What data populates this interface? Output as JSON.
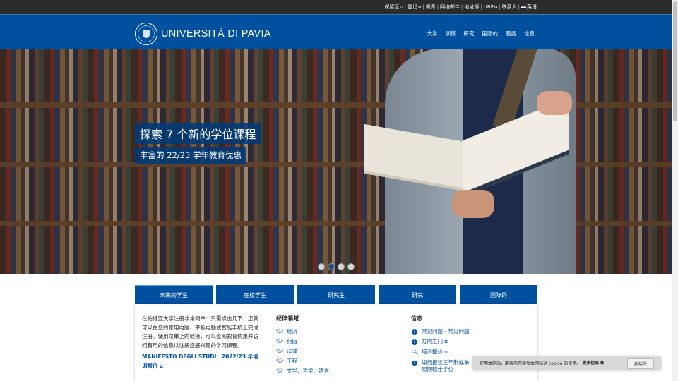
{
  "topbar": {
    "links": [
      {
        "label": "保留区",
        "ext": true
      },
      {
        "label": "登记",
        "ext": true
      },
      {
        "label": "佩奇",
        "ext": false
      },
      {
        "label": "网络邮件",
        "ext": false
      },
      {
        "label": "地址簿",
        "ext": false
      },
      {
        "label": "URP",
        "ext": true
      },
      {
        "label": "联系人",
        "ext": false
      }
    ],
    "language": "英语"
  },
  "header": {
    "brand": "UNIVERSITÀ DI PAVIA",
    "nav": [
      "大学",
      "训练",
      "研究",
      "国际的",
      "服务",
      "信息"
    ]
  },
  "hero": {
    "title": "探索 7 个新的学位课程",
    "subtitle": "丰富的 22/23 学年教育优惠",
    "slides_total": 4,
    "active_slide": 2
  },
  "tabs": [
    {
      "label": "未来的学生",
      "active": true
    },
    {
      "label": "在校学生",
      "active": false
    },
    {
      "label": "研究生",
      "active": false
    },
    {
      "label": "研究",
      "active": false
    },
    {
      "label": "国际的",
      "active": false
    }
  ],
  "content": {
    "intro": "在帕维亚大学注册非常简单：只需点击几下，您就可以在您的家用电脑、平板电脑或智能手机上完成注册。使用菜单上的链接，可以查阅教育优惠并访问有用的信息以注册您感兴趣的学习课程。",
    "manifest_link": "MANIFESTO DEGLI STUDI：2022/23 年培训报价",
    "disciplines": {
      "heading": "纪律领域",
      "items": [
        "经济",
        "药店",
        "法律",
        "工程",
        "文学、哲学、语言"
      ]
    },
    "info": {
      "heading": "信息",
      "items": [
        {
          "label": "常见问题 - 常见问题",
          "icon": "info-icon",
          "ext": false
        },
        {
          "label": "方向之门",
          "icon": "info-icon",
          "ext": true
        },
        {
          "label": "培训报价",
          "icon": "search-icon",
          "ext": true
        },
        {
          "label": "如何报读三年制或单周期硕士学位",
          "icon": "info-icon",
          "ext": false
        }
      ]
    }
  },
  "cookie": {
    "message": "使用本网站，即表示您接受本网站对 cookie 的使用。",
    "more": "更多信息",
    "accept": "我接受"
  }
}
